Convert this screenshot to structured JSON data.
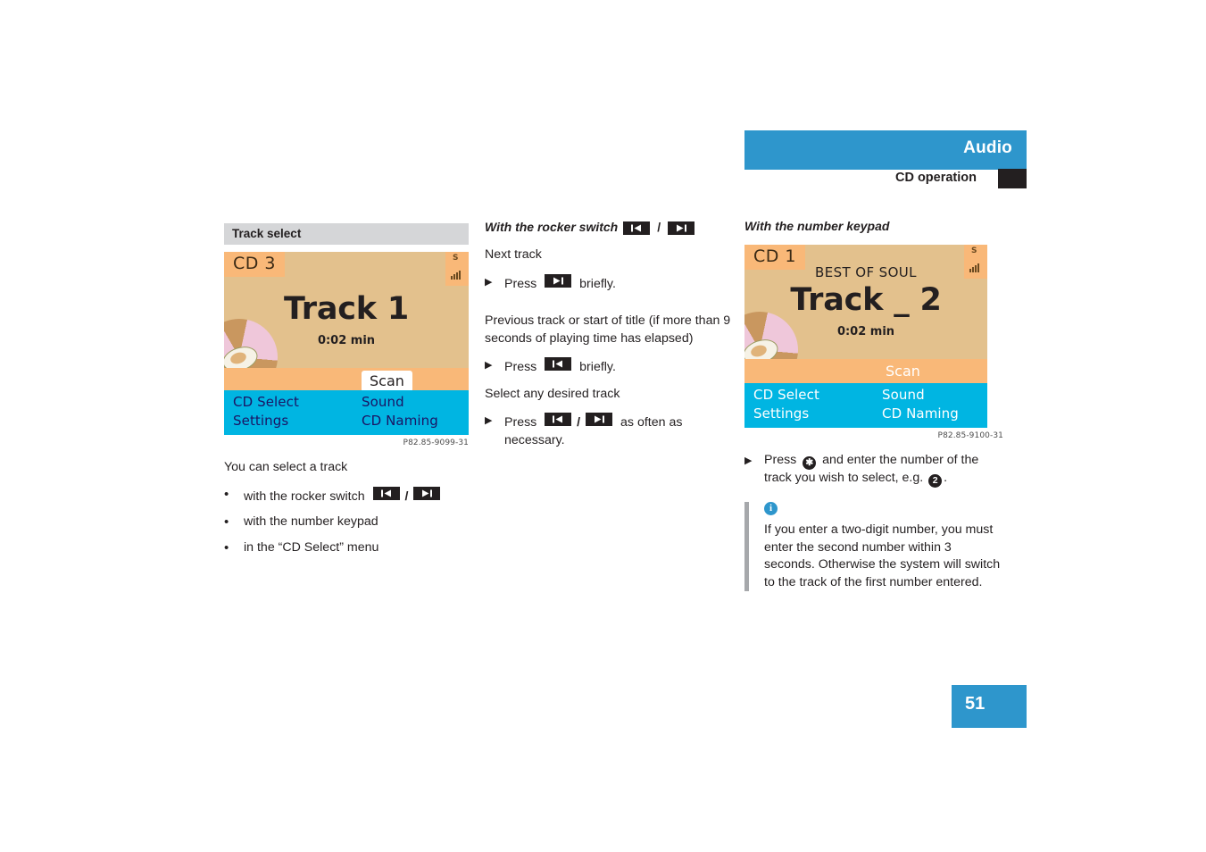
{
  "header": {
    "title": "Audio",
    "subtitle": "CD operation"
  },
  "page_number": "51",
  "left_column": {
    "section_title": "Track select",
    "display": {
      "cd_label": "CD 3",
      "signal_icon": "signal-strength-icon",
      "signal_letter": "S",
      "track_title": "Track 1",
      "time": "0:02 min",
      "scan_label": "Scan",
      "menu": {
        "cd_select": "CD Select",
        "sound": "Sound",
        "settings": "Settings",
        "cd_naming": "CD Naming"
      }
    },
    "figure_code": "P82.85-9099-31",
    "intro": "You can select a track",
    "bullets": [
      {
        "prefix": "with the rocker switch",
        "keys": [
          "prev-track-icon",
          "next-track-icon"
        ],
        "suffix": ""
      },
      {
        "prefix": "with the number keypad",
        "keys": [],
        "suffix": ""
      },
      {
        "prefix": "in the “CD Select” menu",
        "keys": [],
        "suffix": ""
      }
    ]
  },
  "middle_column": {
    "heading": "With the rocker switch",
    "heading_keys": [
      "prev-track-icon",
      "next-track-icon"
    ],
    "next_track_label": "Next track",
    "step_next": {
      "press": "Press",
      "key": "next-track-icon",
      "tail": "briefly."
    },
    "previous_track_label": "Previous track or start of title (if more than 9 seconds of playing time has elapsed)",
    "step_prev": {
      "press": "Press",
      "key": "prev-track-icon",
      "tail": "briefly."
    },
    "select_any_label": "Select any desired track",
    "step_any": {
      "press": "Press",
      "keys": [
        "prev-track-icon",
        "next-track-icon"
      ],
      "tail": "as often as necessary."
    }
  },
  "right_column": {
    "heading": "With the number keypad",
    "display": {
      "cd_label": "CD 1",
      "signal_icon": "signal-strength-icon",
      "signal_letter": "S",
      "album_title": "BEST OF SOUL",
      "track_title": "Track _ 2",
      "time": "0:02 min",
      "scan_label": "Scan",
      "menu": {
        "cd_select": "CD Select",
        "sound": "Sound",
        "settings": "Settings",
        "cd_naming": "CD Naming"
      }
    },
    "figure_code": "P82.85-9100-31",
    "step": {
      "press": "Press",
      "star_key": "✱",
      "middle": "and enter the number of the track you wish to select, e.g.",
      "number_key": "2",
      "end": "."
    },
    "note": {
      "icon": "info-icon",
      "text": "If you enter a two-digit number, you must enter the second number within 3 seconds. Otherwise the system will switch to the track of the first number entered."
    }
  },
  "colors": {
    "brand_blue": "#2e96cc",
    "display_amber": "#e3c18d",
    "display_orange": "#f9b878",
    "display_cyan": "#00b5e2",
    "section_grey": "#d5d6d8",
    "note_rule": "#a6a8ab"
  }
}
